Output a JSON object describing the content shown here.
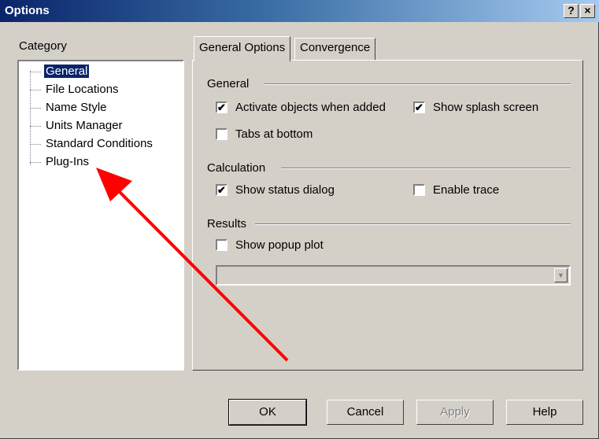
{
  "window": {
    "title": "Options",
    "help_btn": "?",
    "close_btn": "×"
  },
  "category": {
    "label": "Category",
    "items": [
      {
        "label": "General",
        "selected": true
      },
      {
        "label": "File Locations"
      },
      {
        "label": "Name Style"
      },
      {
        "label": "Units Manager"
      },
      {
        "label": "Standard Conditions"
      },
      {
        "label": "Plug-Ins"
      }
    ]
  },
  "tabs": [
    {
      "label": "General Options",
      "active": true
    },
    {
      "label": "Convergence"
    }
  ],
  "general": {
    "label": "General",
    "activate_objects": {
      "label": "Activate objects when added",
      "checked": true
    },
    "show_splash": {
      "label": "Show splash screen",
      "checked": true
    },
    "tabs_bottom": {
      "label": "Tabs at bottom",
      "checked": false
    }
  },
  "calculation": {
    "label": "Calculation",
    "show_status": {
      "label": "Show status dialog",
      "checked": true
    },
    "enable_trace": {
      "label": "Enable trace",
      "checked": false
    }
  },
  "results": {
    "label": "Results",
    "show_popup": {
      "label": "Show popup plot",
      "checked": false
    },
    "plot_select": {
      "value": ""
    }
  },
  "buttons": {
    "ok": "OK",
    "cancel": "Cancel",
    "apply": "Apply",
    "help": "Help"
  },
  "colors": {
    "title_bar": "#0a246a",
    "selection": "#0a246a",
    "annotation_arrow": "#ff0000"
  },
  "icons": {
    "check": "✔",
    "dropdown": "▼"
  }
}
